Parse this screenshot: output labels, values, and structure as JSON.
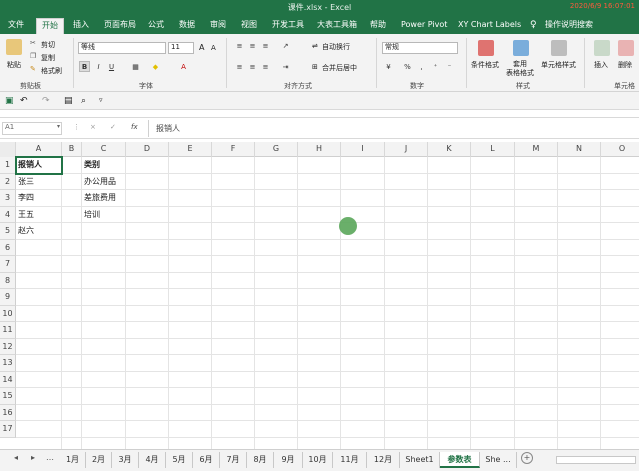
{
  "window": {
    "title": "课件.xlsx  -  Excel",
    "timestamp": "2020/6/9 16:07:01"
  },
  "ribbon_tabs": [
    "文件",
    "开始",
    "插入",
    "页面布局",
    "公式",
    "数据",
    "审阅",
    "视图",
    "开发工具",
    "大表工具箱",
    "帮助",
    "Power Pivot",
    "XY Chart Labels",
    "操作说明搜索"
  ],
  "active_tab": "开始",
  "clipboard": {
    "paste": "粘贴",
    "cut": "剪切",
    "copy": "复制",
    "format_painter": "格式刷",
    "label": "剪贴板"
  },
  "font": {
    "name": "等线",
    "size": "11",
    "label": "字体",
    "grow": "A",
    "shrink": "A",
    "bold": "B",
    "italic": "I",
    "underline": "U"
  },
  "alignment": {
    "wrap": "自动换行",
    "merge": "合并后居中",
    "label": "对齐方式"
  },
  "number": {
    "format": "常规",
    "percent": "%",
    "comma": ",",
    "label": "数字"
  },
  "styles": {
    "conditional": "条件格式",
    "table": "套用\n表格格式",
    "cell": "单元格样式",
    "label": "样式"
  },
  "cells": {
    "insert": "插入",
    "delete": "删除",
    "label": "单元格"
  },
  "formula_bar": {
    "name_box": "A1",
    "content": "报销人",
    "fx": "fx",
    "cancel": "×",
    "confirm": "✓"
  },
  "columns": [
    "A",
    "B",
    "C",
    "D",
    "E",
    "F",
    "G",
    "H",
    "I",
    "J",
    "K",
    "L",
    "M",
    "N",
    "O"
  ],
  "rows": [
    "1",
    "2",
    "3",
    "4",
    "5",
    "6",
    "7",
    "8",
    "9",
    "10",
    "11",
    "12",
    "13",
    "14",
    "15",
    "16",
    "17"
  ],
  "cells_a": [
    "报销人",
    "张三",
    "李四",
    "王五",
    "赵六"
  ],
  "cells_c": [
    "类别",
    "办公用品",
    "差旅费用",
    "培训"
  ],
  "sheets": [
    "1月",
    "2月",
    "3月",
    "4月",
    "5月",
    "6月",
    "7月",
    "8月",
    "9月",
    "10月",
    "11月",
    "12月",
    "Sheet1",
    "参数表",
    "She ..."
  ],
  "active_sheet": "参数表",
  "add_sheet": "+",
  "colors": {
    "accent": "#217346"
  }
}
